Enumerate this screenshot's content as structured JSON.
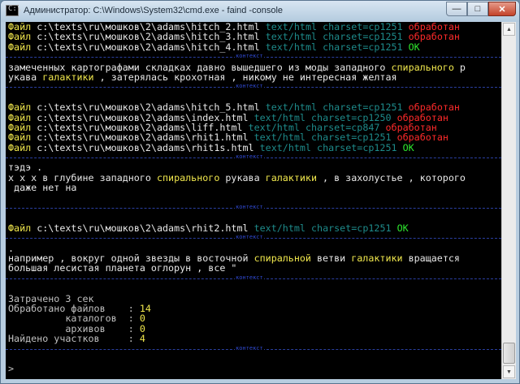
{
  "window": {
    "title": "Администратор: C:\\Windows\\System32\\cmd.exe - faind  -console",
    "icon_text": "C:\\",
    "minimize": "—",
    "maximize": "□",
    "close": "✕"
  },
  "separator_label": "контекст",
  "file_label": "Файл",
  "lines": [
    {
      "type": "file",
      "path": "c:\\texts\\ru\\мошков\\2\\adams\\hitch_2.html",
      "mime": "text/html",
      "charset": "charset=cp1251",
      "status": "обработан",
      "status_color": "red"
    },
    {
      "type": "file",
      "path": "c:\\texts\\ru\\мошков\\2\\adams\\hitch_3.html",
      "mime": "text/html",
      "charset": "charset=cp1251",
      "status": "обработан",
      "status_color": "red"
    },
    {
      "type": "file",
      "path": "c:\\texts\\ru\\мошков\\2\\adams\\hitch_4.html",
      "mime": "text/html",
      "charset": "charset=cp1251",
      "status": "OK",
      "status_color": "green"
    },
    {
      "type": "sep"
    },
    {
      "type": "text",
      "parts": [
        {
          "t": "замеченных картографами складках давно вышедшего из моды западного ",
          "c": "w"
        },
        {
          "t": "спирального",
          "c": "y"
        },
        {
          "t": " р",
          "c": "w"
        }
      ]
    },
    {
      "type": "text",
      "parts": [
        {
          "t": "укава ",
          "c": "w"
        },
        {
          "t": "галактики",
          "c": "y"
        },
        {
          "t": " , затерялась крохотная , никому не интересная желтая",
          "c": "w"
        }
      ]
    },
    {
      "type": "sep"
    },
    {
      "type": "blank"
    },
    {
      "type": "file",
      "path": "c:\\texts\\ru\\мошков\\2\\adams\\hitch_5.html",
      "mime": "text/html",
      "charset": "charset=cp1251",
      "status": "обработан",
      "status_color": "red"
    },
    {
      "type": "file",
      "path": "c:\\texts\\ru\\мошков\\2\\adams\\index.html",
      "mime": "text/html",
      "charset": "charset=cp1250",
      "status": "обработан",
      "status_color": "red"
    },
    {
      "type": "file",
      "path": "c:\\texts\\ru\\мошков\\2\\adams\\liff.html",
      "mime": "text/html",
      "charset": "charset=cp847",
      "status": "обработан",
      "status_color": "red"
    },
    {
      "type": "file",
      "path": "c:\\texts\\ru\\мошков\\2\\adams\\rhit1.html",
      "mime": "text/html",
      "charset": "charset=cp1251",
      "status": "обработан",
      "status_color": "red"
    },
    {
      "type": "file",
      "path": "c:\\texts\\ru\\мошков\\2\\adams\\rhit1s.html",
      "mime": "text/html",
      "charset": "charset=cp1251",
      "status": "OK",
      "status_color": "green"
    },
    {
      "type": "sep"
    },
    {
      "type": "text",
      "parts": [
        {
          "t": "тэдэ .",
          "c": "w"
        }
      ]
    },
    {
      "type": "text",
      "parts": [
        {
          "t": "х х х в глубине западного ",
          "c": "w"
        },
        {
          "t": "спирального",
          "c": "y"
        },
        {
          "t": " рукава ",
          "c": "w"
        },
        {
          "t": "галактики",
          "c": "y"
        },
        {
          "t": " , в захолустье , которого",
          "c": "w"
        }
      ]
    },
    {
      "type": "text",
      "parts": [
        {
          "t": " даже нет на",
          "c": "w"
        }
      ]
    },
    {
      "type": "blank"
    },
    {
      "type": "sep"
    },
    {
      "type": "blank"
    },
    {
      "type": "file",
      "path": "c:\\texts\\ru\\мошков\\2\\adams\\rhit2.html",
      "mime": "text/html",
      "charset": "charset=cp1251",
      "status": "OK",
      "status_color": "green"
    },
    {
      "type": "sep"
    },
    {
      "type": "text",
      "parts": [
        {
          "t": ".",
          "c": "w"
        }
      ]
    },
    {
      "type": "text",
      "parts": [
        {
          "t": "например , вокруг одной звезды в восточной ",
          "c": "w"
        },
        {
          "t": "спиральной",
          "c": "y"
        },
        {
          "t": " ветви ",
          "c": "w"
        },
        {
          "t": "галактики",
          "c": "y"
        },
        {
          "t": " вращается",
          "c": "w"
        }
      ]
    },
    {
      "type": "text",
      "parts": [
        {
          "t": "большая лесистая планета оглорун , все \"",
          "c": "w"
        }
      ]
    },
    {
      "type": "sep"
    },
    {
      "type": "blank"
    },
    {
      "type": "text",
      "parts": [
        {
          "t": "Затрачено 3 сек",
          "c": "gr"
        }
      ]
    },
    {
      "type": "text",
      "parts": [
        {
          "t": "Обработано файлов    : ",
          "c": "gr"
        },
        {
          "t": "14",
          "c": "y"
        }
      ]
    },
    {
      "type": "text",
      "parts": [
        {
          "t": "          каталогов  : ",
          "c": "gr"
        },
        {
          "t": "0",
          "c": "y"
        }
      ]
    },
    {
      "type": "text",
      "parts": [
        {
          "t": "          архивов    : ",
          "c": "gr"
        },
        {
          "t": "0",
          "c": "y"
        }
      ]
    },
    {
      "type": "text",
      "parts": [
        {
          "t": "Найдено участков     : ",
          "c": "gr"
        },
        {
          "t": "4",
          "c": "y"
        }
      ]
    },
    {
      "type": "sep"
    },
    {
      "type": "blank"
    },
    {
      "type": "text",
      "parts": [
        {
          "t": ">",
          "c": "gr"
        }
      ]
    }
  ]
}
